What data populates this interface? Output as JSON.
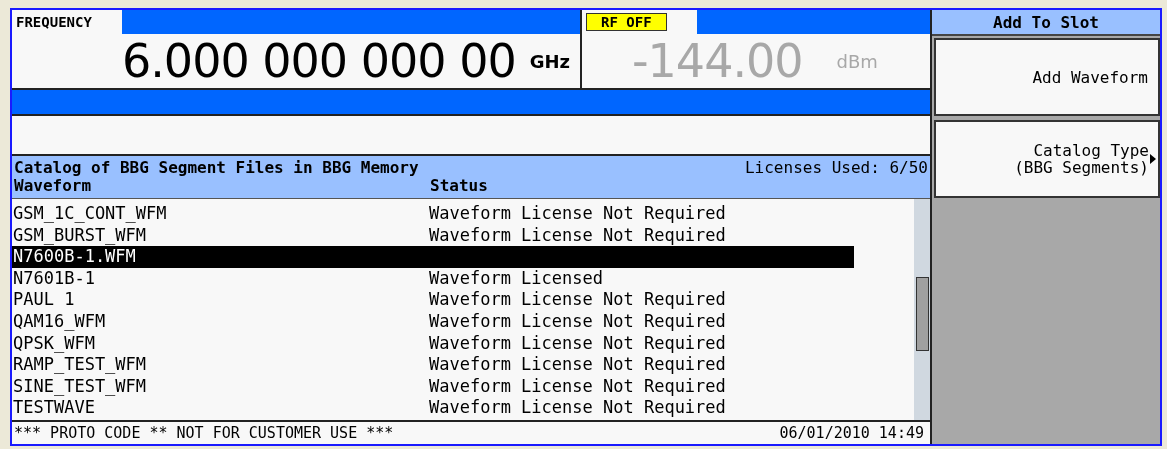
{
  "frequency": {
    "label": "FREQUENCY",
    "value": "6.000 000 000 00",
    "unit": "GHz"
  },
  "amplitude": {
    "badge": "RF OFF",
    "value": "-144.00",
    "unit": "dBm",
    "rf_on": false
  },
  "catalog": {
    "title": "Catalog of BBG Segment Files in BBG Memory",
    "licenses": "Licenses Used: 6/50",
    "columns": [
      "Waveform",
      "Status"
    ],
    "rows": [
      {
        "name": "GSM_1C_CONT_WFM",
        "status": "Waveform License Not Required",
        "selected": false
      },
      {
        "name": "GSM_BURST_WFM",
        "status": "Waveform License Not Required",
        "selected": false
      },
      {
        "name": "N7600B-1.WFM",
        "selected": true
      },
      {
        "name": "N7601B-1",
        "status": "Waveform Licensed",
        "selected": false
      },
      {
        "name": "PAUL 1",
        "status": "Waveform License Not Required",
        "selected": false
      },
      {
        "name": "QAM16_WFM",
        "status": "Waveform License Not Required",
        "selected": false
      },
      {
        "name": "QPSK_WFM",
        "status": "Waveform License Not Required",
        "selected": false
      },
      {
        "name": "RAMP_TEST_WFM",
        "status": "Waveform License Not Required",
        "selected": false
      },
      {
        "name": "SINE_TEST_WFM",
        "status": "Waveform License Not Required",
        "selected": false
      },
      {
        "name": "TESTWAVE",
        "status": "Waveform License Not Required",
        "selected": false
      }
    ]
  },
  "status_bar": {
    "message": "*** PROTO CODE ** NOT FOR CUSTOMER USE ***",
    "datetime": "06/01/2010 14:49"
  },
  "softkeys": {
    "title": "Add To Slot",
    "keys": [
      {
        "lines": [
          "Add Waveform"
        ],
        "submenu": false
      },
      {
        "lines": [
          "Catalog Type",
          "(BBG Segments)"
        ],
        "submenu": true
      }
    ]
  }
}
